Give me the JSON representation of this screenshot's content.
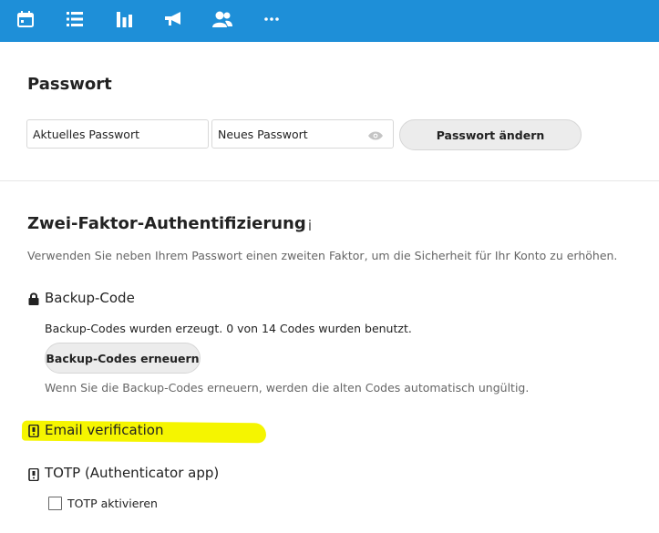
{
  "topbar": {
    "icons": [
      "calendar-icon",
      "tasks-list-icon",
      "activity-chart-icon",
      "announcement-megaphone-icon",
      "contacts-icon",
      "more-dots-icon"
    ],
    "color": "#1e8fd8"
  },
  "password_section": {
    "title": "Passwort",
    "current_placeholder": "Aktuelles Passwort",
    "new_placeholder": "Neues Passwort",
    "change_button": "Passwort ändern"
  },
  "twofa": {
    "title": "Zwei-Faktor-Authentifizierung",
    "info_glyph": "i",
    "description": "Verwenden Sie neben Ihrem Passwort einen zweiten Faktor, um die Sicherheit für Ihr Konto zu erhöhen.",
    "backup": {
      "label": "Backup-Code",
      "status": "Backup-Codes wurden erzeugt. 0 von 14 Codes wurden benutzt.",
      "regen_button": "Backup-Codes erneuern",
      "hint": "Wenn Sie die Backup-Codes erneuern, werden die alten Codes automatisch ungültig."
    },
    "email": {
      "label": "Email verification"
    },
    "totp": {
      "label": "TOTP (Authenticator app)",
      "checkbox_label": "TOTP aktivieren"
    }
  }
}
